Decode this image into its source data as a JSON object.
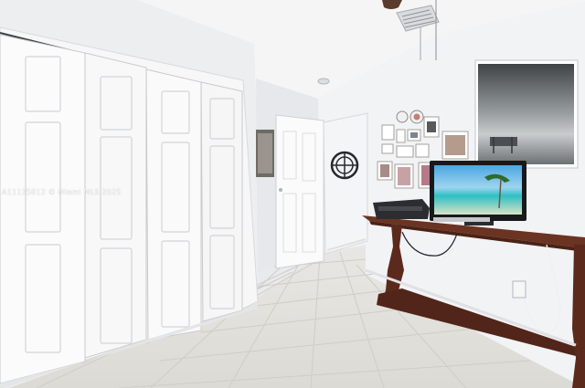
{
  "photo": {
    "subject": "bedroom interior",
    "watermark": "A11135812 © Miami MLS 2025"
  },
  "colors": {
    "wall": "#f1f2f4",
    "ceiling": "#f6f6f7",
    "closet_door": "#fbfbfc",
    "floor_tile": "#e2e1dc",
    "console_wood": "#5c2a1d",
    "tv_screen_sky": "#5fb9e8",
    "tv_screen_sea": "#36c6c4"
  },
  "icons": {
    "ceiling_fan": "ceiling-fan-icon",
    "air_vent": "air-vent-icon",
    "wall_mirror": "round-mirror-icon"
  }
}
